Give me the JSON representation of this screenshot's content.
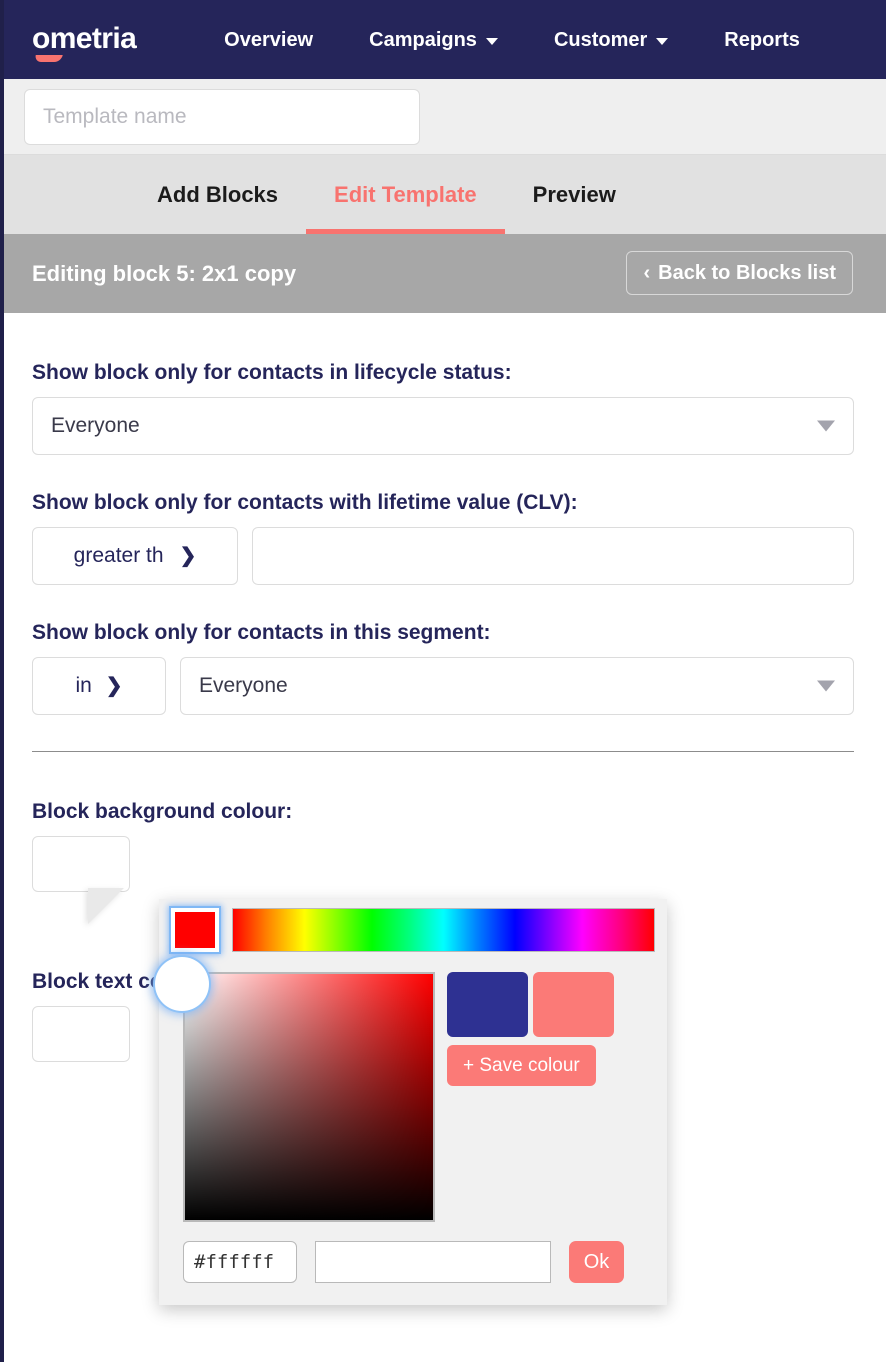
{
  "navbar": {
    "logo": "ometria",
    "items": [
      {
        "label": "Overview",
        "has_caret": false
      },
      {
        "label": "Campaigns",
        "has_caret": true
      },
      {
        "label": "Customer",
        "has_caret": true
      },
      {
        "label": "Reports",
        "has_caret": false
      }
    ]
  },
  "template_bar": {
    "name_value": "",
    "name_placeholder": "Template name"
  },
  "tabs": [
    {
      "label": "Add Blocks",
      "active": false
    },
    {
      "label": "Edit Template",
      "active": true
    },
    {
      "label": "Preview",
      "active": false
    }
  ],
  "edit_header": {
    "title": "Editing block 5: 2x1 copy",
    "back_chevron": "‹",
    "back_label": "Back to Blocks list"
  },
  "form": {
    "lifecycle": {
      "label": "Show block only for contacts in lifecycle status:",
      "value": "Everyone"
    },
    "clv": {
      "label": "Show block only for contacts with lifetime value (CLV):",
      "operator": "greater th",
      "value": "",
      "placeholder": ""
    },
    "segment": {
      "label": "Show block only for contacts in this segment:",
      "operator": "in",
      "value": "Everyone"
    },
    "bg_colour": {
      "label": "Block background colour:",
      "value": "#ffffff"
    },
    "text_colour": {
      "label": "Block text colour:",
      "value": "#ffffff"
    }
  },
  "colour_picker": {
    "current_hue_colour": "#ff0000",
    "saved_colours": [
      {
        "name": "indigo",
        "hex": "#2e3192"
      },
      {
        "name": "coral",
        "hex": "#fb7a77"
      }
    ],
    "save_colour_label": "+ Save colour",
    "hex_value": "#ffffff",
    "name_value": "",
    "name_placeholder": "",
    "ok_label": "Ok"
  },
  "colors": {
    "navbar_bg": "#25255a",
    "accent_coral": "#f8736f",
    "tabs_bg": "#e1e1e1",
    "edit_header_bg": "#a7a7a7",
    "label_navy": "#25255a",
    "picker_bg": "#f1f1f1"
  }
}
